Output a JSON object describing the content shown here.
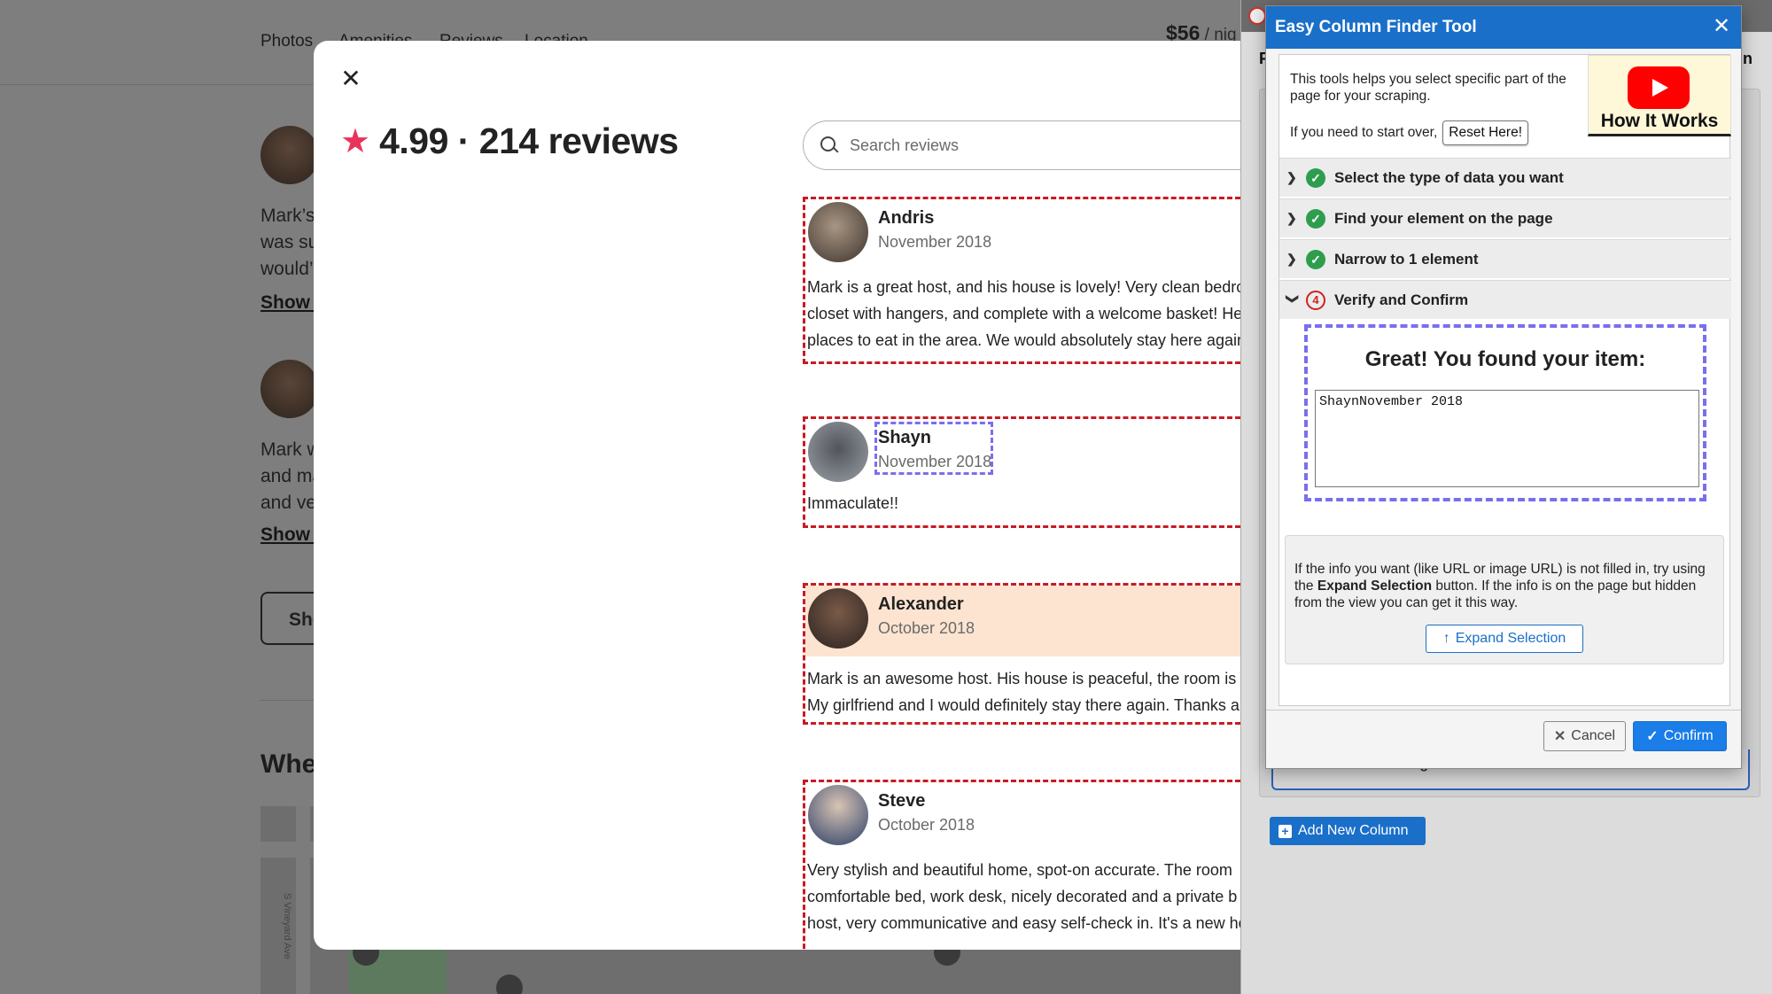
{
  "background": {
    "nav_links": [
      "Photos",
      "Amenities",
      "Reviews",
      "Location"
    ],
    "price": "$56",
    "price_unit": " / nig",
    "review_snippets": [
      [
        "Mark’s",
        "was su",
        "would’"
      ],
      [
        "Mark w",
        "and ma",
        "and ve"
      ]
    ],
    "show_more": "Show m",
    "show_all_button": "Sho",
    "where_heading": "Whe",
    "map_street": "S Vineyard Ave"
  },
  "modal": {
    "close_icon": "✕",
    "rating": "4.99 · 214 reviews",
    "search_placeholder": "Search reviews",
    "reviews": [
      {
        "name": "Andris",
        "date": "November 2018",
        "lines": [
          "Mark is a great host, and his house is lovely! Very clean bedroo",
          "closet with hangers, and complete with a welcome basket! He",
          "places to eat in the area. We would absolutely stay here again"
        ]
      },
      {
        "name": "Shayn",
        "date": "November 2018",
        "lines": [
          "Immaculate!!"
        ]
      },
      {
        "name": "Alexander",
        "date": "October 2018",
        "lines": [
          "Mark is an awesome host. His house is peaceful, the room is sp",
          "My girlfriend and I would definitely stay there again. Thanks a"
        ]
      },
      {
        "name": "Steve",
        "date": "October 2018",
        "lines": [
          "Very stylish and beautiful home, spot-on accurate. The room",
          "comfortable bed, work desk, nicely decorated and a private b",
          "host, very communicative and easy self-check in. It's a new ho"
        ]
      }
    ]
  },
  "extension": {
    "left_letter": "F",
    "right_letter": "n",
    "advanced_settings": "Advanced Settings",
    "add_column": "Add New Column",
    "dialog": {
      "title": "Easy Column Finder Tool",
      "close_icon": "✕",
      "intro": "This tools helps you select specific part of the page for your scraping.",
      "reset_prompt": "If you need to start over,",
      "reset_button": "Reset Here!",
      "how_it_works": "How It Works",
      "steps": [
        {
          "label": "Select the type of data you want",
          "status": "done"
        },
        {
          "label": "Find your element on the page",
          "status": "done"
        },
        {
          "label": "Narrow to 1 element",
          "status": "done"
        },
        {
          "label": "Verify and Confirm",
          "status": "current",
          "number": "4"
        }
      ],
      "found_heading": "Great! You found your item:",
      "found_value": "ShaynNovember 2018",
      "info_prefix": "If the info you want (like URL or image URL) is not filled in, try using the ",
      "info_bold": "Expand Selection",
      "info_suffix": " button. If the info is on the page but hidden from the view you can get it this way.",
      "expand_button": "Expand Selection",
      "cancel_button": "Cancel",
      "confirm_button": "Confirm"
    }
  },
  "colors": {
    "accent": "#1a6fc9",
    "star": "#e8345a",
    "selection_red": "#c81a22",
    "selection_purple": "#7a6ef0",
    "step_done_green": "#2e9e4e"
  }
}
